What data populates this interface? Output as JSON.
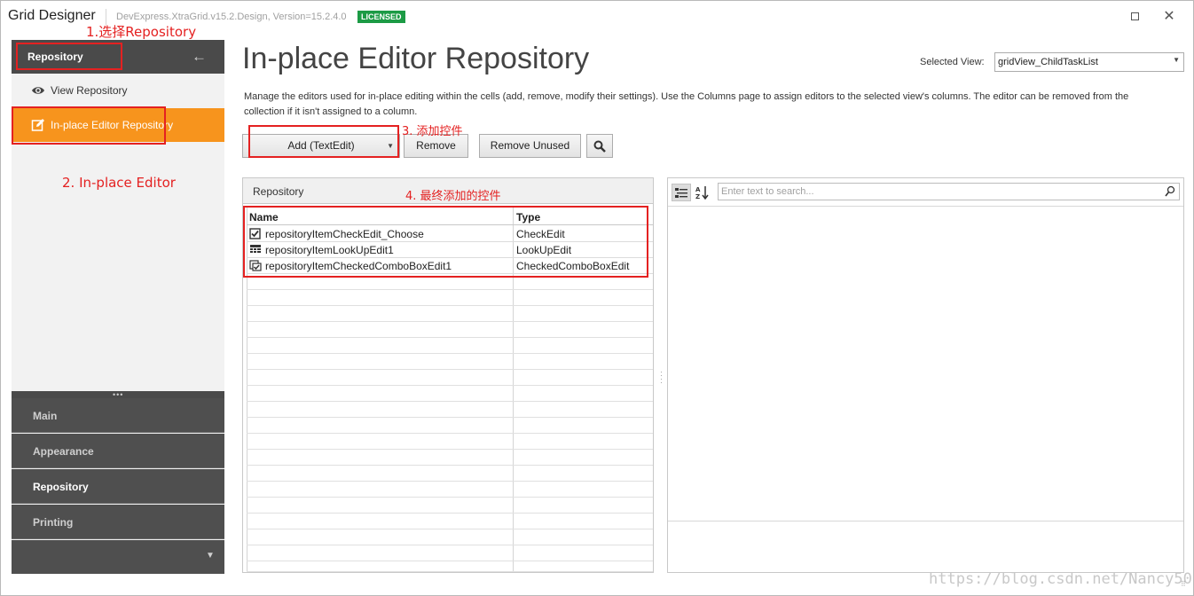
{
  "window": {
    "title": "Grid Designer",
    "version": "DevExpress.XtraGrid.v15.2.Design, Version=15.2.4.0",
    "license_badge": "LICENSED",
    "accent_color": "#f7941d"
  },
  "nav": {
    "header": "Repository",
    "items": [
      {
        "label": "View Repository",
        "icon": "eye-icon"
      },
      {
        "label": "In-place Editor Repository",
        "icon": "edit-icon",
        "selected": true
      }
    ],
    "groups": [
      {
        "label": "Main"
      },
      {
        "label": "Appearance"
      },
      {
        "label": "Repository",
        "active": true
      },
      {
        "label": "Printing"
      }
    ]
  },
  "main": {
    "title": "In-place Editor Repository",
    "selected_view_label": "Selected View:",
    "selected_view_value": "gridView_ChildTaskList",
    "description": "Manage the editors used for in-place editing within the cells (add, remove, modify their settings). Use the Columns page to assign editors to the selected view's columns. The editor can be removed from the collection if it isn't assigned to a column.",
    "buttons": {
      "add": "Add (TextEdit)",
      "remove": "Remove",
      "remove_unused": "Remove Unused"
    }
  },
  "grid": {
    "caption": "Repository",
    "columns": [
      "Name",
      "Type"
    ],
    "rows": [
      {
        "name": "repositoryItemCheckEdit_Choose",
        "type": "CheckEdit",
        "icon": "checkbox-icon"
      },
      {
        "name": "repositoryItemLookUpEdit1",
        "type": "LookUpEdit",
        "icon": "lookup-grid-icon"
      },
      {
        "name": "repositoryItemCheckedComboBoxEdit1",
        "type": "CheckedComboBoxEdit",
        "icon": "checked-combo-icon"
      }
    ]
  },
  "properties": {
    "search_placeholder": "Enter text to search..."
  },
  "annotations": {
    "step1": "1.选择Repository",
    "step2": "2. In-place Editor",
    "step3": "3. 添加控件",
    "step4": "4. 最终添加的控件"
  },
  "watermark": "https://blog.csdn.net/Nancy50"
}
